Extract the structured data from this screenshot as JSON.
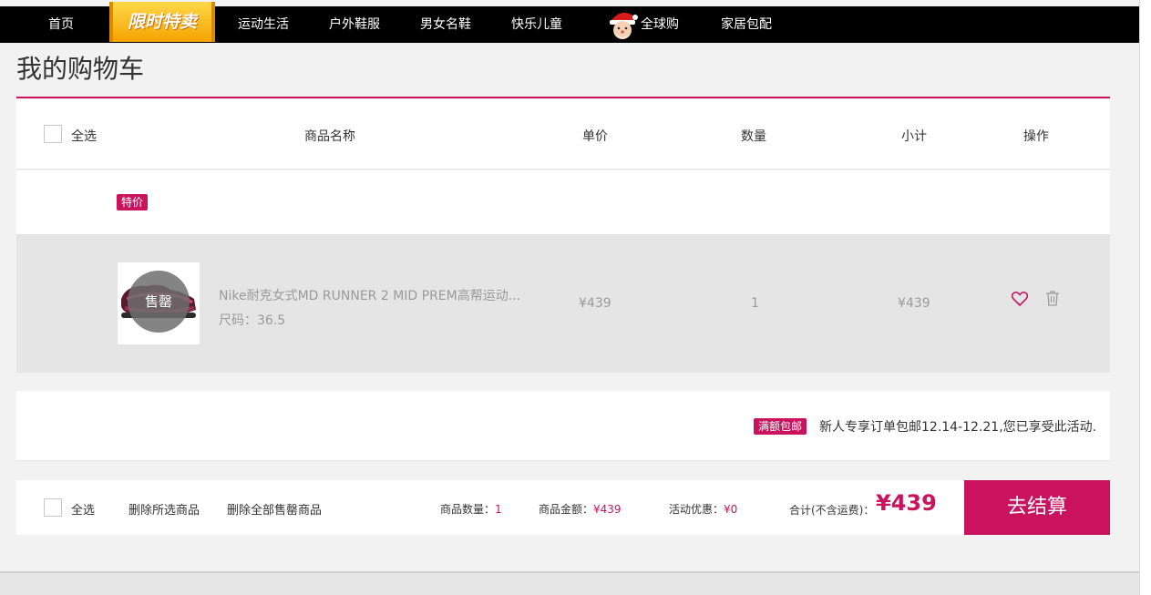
{
  "nav": {
    "items": [
      "首页",
      "运动生活",
      "户外鞋服",
      "男女名鞋",
      "快乐儿童",
      "全球购",
      "家居包配"
    ],
    "flash_sale": "限时特卖"
  },
  "page_title": "我的购物车",
  "header": {
    "select_all": "全选",
    "product_name": "商品名称",
    "unit_price": "单价",
    "quantity": "数量",
    "subtotal": "小计",
    "actions": "操作"
  },
  "group": {
    "badge": "特价"
  },
  "item": {
    "name": "Nike耐克女式MD RUNNER 2 MID PREM高帮运动...",
    "size": "尺码：36.5",
    "status": "售罄",
    "price": "¥439",
    "quantity": "1",
    "subtotal": "¥439"
  },
  "promo": {
    "badge": "满额包邮",
    "text": "新人专享订单包邮12.14-12.21,您已享受此活动."
  },
  "footer": {
    "select_all": "全选",
    "delete_selected": "删除所选商品",
    "delete_soldout": "删除全部售罄商品",
    "count_label": "商品数量：",
    "count_value": "1",
    "amount_label": "商品金额：",
    "amount_value": "¥439",
    "discount_label": "活动优惠：",
    "discount_value": "¥0",
    "total_label": "合计(不含运费)：",
    "total_value": "¥439",
    "checkout": "去结算"
  },
  "colors": {
    "accent": "#c9135e",
    "nav_bg": "#000000",
    "flash_sale": "#f5a300"
  },
  "icons": [
    "santa-icon",
    "heart-icon",
    "trash-icon"
  ]
}
